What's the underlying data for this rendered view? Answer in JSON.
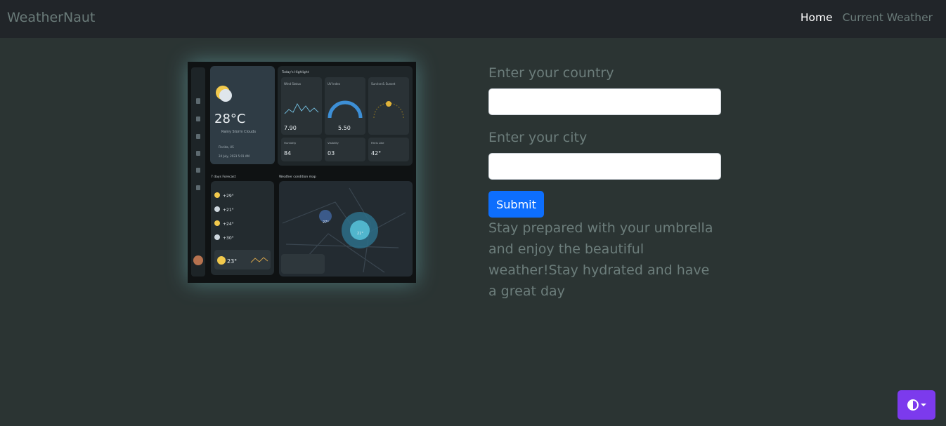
{
  "navbar": {
    "brand": "WeatherNaut",
    "links": [
      {
        "label": "Home",
        "active": true
      },
      {
        "label": "Current Weather",
        "active": false
      }
    ]
  },
  "preview": {
    "today_highlight": "Today's Highlight",
    "temperature": "28°C",
    "condition": "Rainy Storm Clouds",
    "location": "Florida, US",
    "date_time": "24 July, 2023  5:01 AM",
    "wind_status_label": "Wind Status",
    "wind_value": "7.90",
    "uv_label": "UV Index",
    "uv_value": "5.50",
    "sun_label": "Sunrise & Sunset",
    "humidity_label": "Humidity",
    "humidity_value": "84",
    "visibility_label": "Visibility",
    "visibility_value": "03",
    "feels_label": "Feels Like",
    "feels_value": "42°",
    "forecast_label": "7 days Forecast",
    "forecast_temps": [
      "+29°",
      "+21°",
      "+24°",
      "+30°"
    ],
    "map_label": "Weather condition map",
    "tomorrow_temp": "23°",
    "map_temp_1": "27°",
    "map_temp_2": "21°"
  },
  "form": {
    "country_label": "Enter your country",
    "country_value": "",
    "city_label": "Enter your city",
    "city_value": "",
    "submit_label": "Submit",
    "message": "Stay prepared with your umbrella and enjoy the beautiful weather!Stay hydrated and have a great day"
  },
  "colors": {
    "background": "#2b3433",
    "navbar": "#212529",
    "submit": "#0d6efd",
    "theme_toggle": "#7c3aed"
  },
  "icons": [
    "contrast-icon",
    "caret-down-icon"
  ]
}
